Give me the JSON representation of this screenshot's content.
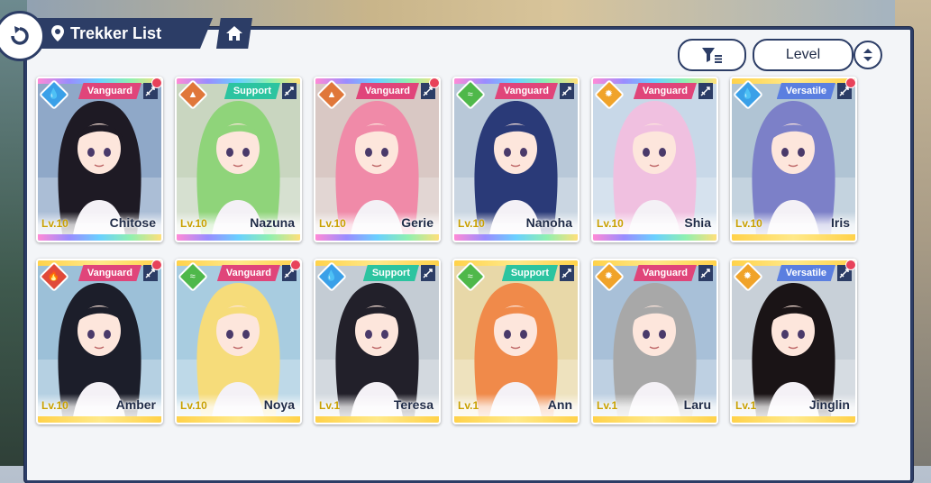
{
  "header": {
    "title": "Trekker List"
  },
  "controls": {
    "sort_label": "Level"
  },
  "colors": {
    "navy": "#2c3d66",
    "vanguard": "#e0457a",
    "support": "#2cc4a0",
    "versatile": "#5b7fe0",
    "water": "#3aa0e8",
    "earth": "#e0773a",
    "wind": "#4fb84a",
    "light": "#f0a32a",
    "fire": "#e04a3a"
  },
  "trekkers": [
    {
      "name": "Chitose",
      "level": "Lv.10",
      "role": "Vanguard",
      "element": "water",
      "dot": true,
      "hair": "#1e1a24",
      "bg": "#8fa8c8",
      "rarity": "rainbow"
    },
    {
      "name": "Nazuna",
      "level": "Lv.10",
      "role": "Support",
      "element": "earth",
      "dot": false,
      "hair": "#8fd47a",
      "bg": "#c9d6c0",
      "rarity": "rainbow"
    },
    {
      "name": "Gerie",
      "level": "Lv.10",
      "role": "Vanguard",
      "element": "earth",
      "dot": true,
      "hair": "#f08aa8",
      "bg": "#d9c8c4",
      "rarity": "rainbow"
    },
    {
      "name": "Nanoha",
      "level": "Lv.10",
      "role": "Vanguard",
      "element": "wind",
      "dot": false,
      "hair": "#2a3a78",
      "bg": "#b8c8d8",
      "rarity": "rainbow"
    },
    {
      "name": "Shia",
      "level": "Lv.10",
      "role": "Vanguard",
      "element": "light",
      "dot": false,
      "hair": "#f0c0e0",
      "bg": "#c8d8e8",
      "rarity": "rainbow"
    },
    {
      "name": "Iris",
      "level": "Lv.10",
      "role": "Versatile",
      "element": "water",
      "dot": true,
      "hair": "#7c80c8",
      "bg": "#b0c4d4",
      "rarity": "gold"
    },
    {
      "name": "Amber",
      "level": "Lv.10",
      "role": "Vanguard",
      "element": "fire",
      "dot": true,
      "hair": "#1c1e2a",
      "bg": "#9cc0d8",
      "rarity": "gold"
    },
    {
      "name": "Noya",
      "level": "Lv.10",
      "role": "Vanguard",
      "element": "wind",
      "dot": true,
      "hair": "#f6dc7a",
      "bg": "#a8cce0",
      "rarity": "gold"
    },
    {
      "name": "Teresa",
      "level": "Lv.1",
      "role": "Support",
      "element": "water",
      "dot": false,
      "hair": "#22202a",
      "bg": "#c4ccd4",
      "rarity": "gold"
    },
    {
      "name": "Ann",
      "level": "Lv.1",
      "role": "Support",
      "element": "wind",
      "dot": false,
      "hair": "#f08a4a",
      "bg": "#e8d8a8",
      "rarity": "gold"
    },
    {
      "name": "Laru",
      "level": "Lv.1",
      "role": "Vanguard",
      "element": "light",
      "dot": false,
      "hair": "#a8a8a8",
      "bg": "#a8c0d8",
      "rarity": "gold"
    },
    {
      "name": "Jinglin",
      "level": "Lv.1",
      "role": "Versatile",
      "element": "light",
      "dot": true,
      "hair": "#1a1416",
      "bg": "#c8d0d8",
      "rarity": "gold"
    }
  ]
}
